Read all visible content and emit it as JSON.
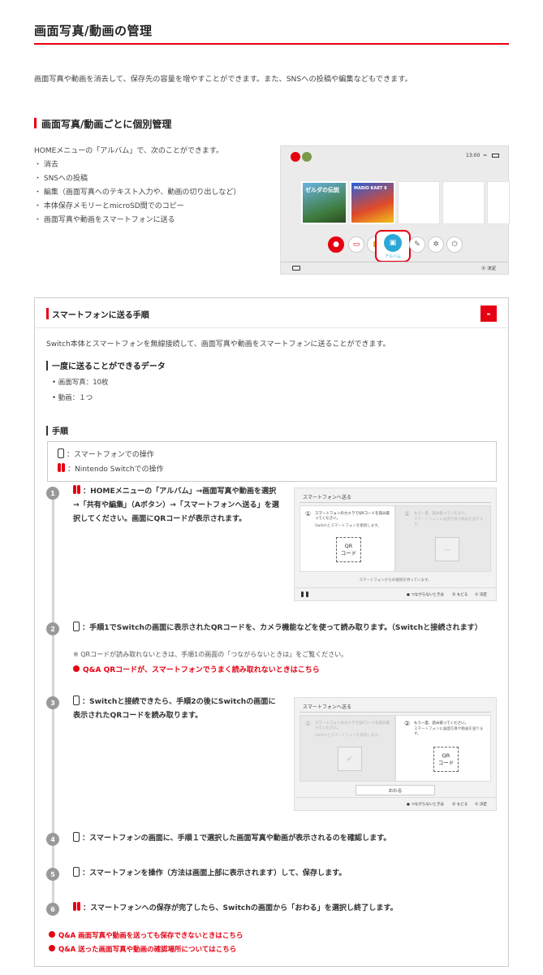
{
  "page": {
    "title": "画面写真/動画の管理",
    "intro": "画面写真や動画を消去して、保存先の容量を増やすことができます。また、SNSへの投稿や編集などもできます。"
  },
  "section1": {
    "heading": "画面写真/動画ごとに個別管理",
    "lead": "HOMEメニューの「アルバム」で、次のことができます。",
    "items": [
      "・ 消去",
      "・ SNSへの投稿",
      "・ 編集（画面写真へのテキスト入力や、動画の切り出しなど）",
      "・ 本体保存メモリーとmicroSD間でのコピー",
      "・ 画面写真や動画をスマートフォンに送る"
    ],
    "home_screen": {
      "time": "13:00",
      "album_label": "アルバム",
      "confirm": "決定",
      "game1": "ゼルダの伝説",
      "game2": "MARIO KART 8"
    }
  },
  "accordion": {
    "title": "スマートフォンに送る手順",
    "toggle": "-",
    "desc": "Switch本体とスマートフォンを無線接続して、画面写真や動画をスマートフォンに送ることができます。",
    "data_heading": "一度に送ることができるデータ",
    "data_items": [
      "画面写真：10枚",
      "動画：１つ"
    ],
    "proc_heading": "手順",
    "legend": {
      "phone": "：スマートフォンでの操作",
      "switch": "：Nintendo Switchでの操作"
    },
    "steps": [
      {
        "num": "1",
        "text": "：HOMEメニューの「アルバム」→画面写真や動画を選択→「共有や編集」（Aボタン）→「スマートフォンへ送る」を選択してください。画面にQRコードが表示されます。"
      },
      {
        "num": "2",
        "text": "：手順1でSwitchの画面に表示されたQRコードを、カメラ機能などを使って読み取ります。（Switchと接続されます）",
        "note": "※ QRコードが読み取れないときは、手順1の画面の「つながらないときは」をご覧ください。",
        "link": "Q&A QRコードが、スマートフォンでうまく読み取れないときはこちら"
      },
      {
        "num": "3",
        "text": "：Switchと接続できたら、手順2の後にSwitchの画面に表示されたQRコードを読み取ります。"
      },
      {
        "num": "4",
        "text": "：スマートフォンの画面に、手順１で選択した画面写真や動画が表示されるのを確認します。"
      },
      {
        "num": "5",
        "text": "：スマートフォンを操作（方法は画面上部に表示されます）して、保存します。"
      },
      {
        "num": "6",
        "text": "：スマートフォンへの保存が完了したら、Switchの画面から「おわる」を選択し終了します。"
      }
    ],
    "screens": {
      "title": "スマートフォンへ送る",
      "p1": "スマートフォンのカメラでQRコードを読み取ってください。",
      "p1sub": "Switchとスマートフォンを接続します。",
      "p2": "もう一度、読み取ってください。",
      "p2sub": "スマートフォンに画面写真や動画を送ります。",
      "qr": "QR\nコード",
      "waiting": "スマートフォンからの接続を待っています。",
      "help": "つながらないときは",
      "back": "もどる",
      "ok": "決定",
      "end": "おわる"
    },
    "links": [
      "Q&A 画面写真や動画を送っても保存できないときはこちら",
      "Q&A 送った画面写真や動画の確認場所についてはこちら"
    ]
  }
}
